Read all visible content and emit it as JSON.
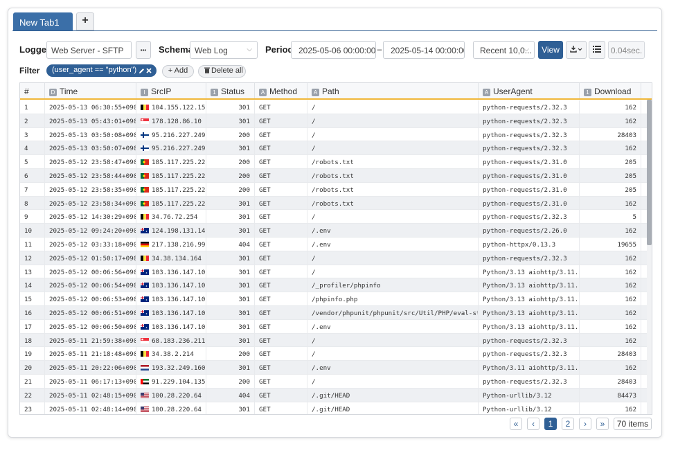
{
  "tabs": {
    "active_label": "New Tab1",
    "add_label": "+"
  },
  "controls": {
    "logger_label": "Logger",
    "logger_value": "Web Server - SFTP",
    "more_label": "•••",
    "schema_label": "Schema",
    "schema_value": "Web Log",
    "period_label": "Period",
    "period_from": "2025-05-06 00:00:00",
    "period_sep": "–",
    "period_to": "2025-05-14 00:00:00",
    "recent_value": "Recent 10,0...",
    "view_label": "View",
    "elapsed": "0.04sec."
  },
  "filter": {
    "label": "Filter",
    "expression": "(user_agent == \"python\")",
    "add_label": "+ Add",
    "delete_label": "Delete all"
  },
  "columns": [
    {
      "type": "",
      "label": "#"
    },
    {
      "type": "D",
      "label": "Time"
    },
    {
      "type": "I",
      "label": "SrcIP"
    },
    {
      "type": "1",
      "label": "Status"
    },
    {
      "type": "A",
      "label": "Method"
    },
    {
      "type": "A",
      "label": "Path"
    },
    {
      "type": "A",
      "label": "UserAgent"
    },
    {
      "type": "1",
      "label": "Download"
    }
  ],
  "rows": [
    [
      "1",
      "2025-05-13 06:30:55+0900",
      "BE",
      "104.155.122.159",
      "301",
      "GET",
      "/",
      "python-requests/2.32.3",
      "162"
    ],
    [
      "2",
      "2025-05-13 05:43:01+0900",
      "SG",
      "178.128.86.10",
      "301",
      "GET",
      "/",
      "python-requests/2.32.3",
      "162"
    ],
    [
      "3",
      "2025-05-13 03:50:08+0900",
      "FI",
      "95.216.227.249",
      "200",
      "GET",
      "/",
      "python-requests/2.32.3",
      "28403"
    ],
    [
      "4",
      "2025-05-13 03:50:07+0900",
      "FI",
      "95.216.227.249",
      "301",
      "GET",
      "/",
      "python-requests/2.32.3",
      "162"
    ],
    [
      "5",
      "2025-05-12 23:58:47+0900",
      "PT",
      "185.117.225.224",
      "200",
      "GET",
      "/robots.txt",
      "python-requests/2.31.0",
      "205"
    ],
    [
      "6",
      "2025-05-12 23:58:44+0900",
      "PT",
      "185.117.225.224",
      "200",
      "GET",
      "/robots.txt",
      "python-requests/2.31.0",
      "205"
    ],
    [
      "7",
      "2025-05-12 23:58:35+0900",
      "PT",
      "185.117.225.224",
      "200",
      "GET",
      "/robots.txt",
      "python-requests/2.31.0",
      "205"
    ],
    [
      "8",
      "2025-05-12 23:58:34+0900",
      "PT",
      "185.117.225.224",
      "301",
      "GET",
      "/robots.txt",
      "python-requests/2.31.0",
      "162"
    ],
    [
      "9",
      "2025-05-12 14:30:29+0900",
      "BE",
      "34.76.72.254",
      "301",
      "GET",
      "/",
      "python-requests/2.32.3",
      "5"
    ],
    [
      "10",
      "2025-05-12 09:24:20+0900",
      "AU",
      "124.198.131.143",
      "301",
      "GET",
      "/.env",
      "python-requests/2.26.0",
      "162"
    ],
    [
      "11",
      "2025-05-12 03:33:18+0900",
      "DE",
      "217.138.216.99",
      "404",
      "GET",
      "/.env",
      "python-httpx/0.13.3",
      "19655"
    ],
    [
      "12",
      "2025-05-12 01:50:17+0900",
      "BE",
      "34.38.134.164",
      "301",
      "GET",
      "/",
      "python-requests/2.32.3",
      "162"
    ],
    [
      "13",
      "2025-05-12 00:06:56+0900",
      "AU",
      "103.136.147.107",
      "301",
      "GET",
      "/",
      "Python/3.13 aiohttp/3.11.12",
      "162"
    ],
    [
      "14",
      "2025-05-12 00:06:54+0900",
      "AU",
      "103.136.147.107",
      "301",
      "GET",
      "/_profiler/phpinfo",
      "Python/3.13 aiohttp/3.11.12",
      "162"
    ],
    [
      "15",
      "2025-05-12 00:06:53+0900",
      "AU",
      "103.136.147.107",
      "301",
      "GET",
      "/phpinfo.php",
      "Python/3.13 aiohttp/3.11.12",
      "162"
    ],
    [
      "16",
      "2025-05-12 00:06:51+0900",
      "AU",
      "103.136.147.107",
      "301",
      "GET",
      "/vendor/phpunit/phpunit/src/Util/PHP/eval-stdin.php",
      "Python/3.13 aiohttp/3.11.12",
      "162"
    ],
    [
      "17",
      "2025-05-12 00:06:50+0900",
      "AU",
      "103.136.147.107",
      "301",
      "GET",
      "/.env",
      "Python/3.13 aiohttp/3.11.12",
      "162"
    ],
    [
      "18",
      "2025-05-11 21:59:38+0900",
      "SG",
      "68.183.236.211",
      "301",
      "GET",
      "/",
      "python-requests/2.32.3",
      "162"
    ],
    [
      "19",
      "2025-05-11 21:18:48+0900",
      "BE",
      "34.38.2.214",
      "200",
      "GET",
      "/",
      "python-requests/2.32.3",
      "28403"
    ],
    [
      "20",
      "2025-05-11 20:22:06+0900",
      "NL",
      "193.32.249.160",
      "301",
      "GET",
      "/.env",
      "Python/3.11 aiohttp/3.11.18",
      "162"
    ],
    [
      "21",
      "2025-05-11 06:17:13+0900",
      "AE",
      "91.229.104.135",
      "200",
      "GET",
      "/",
      "python-requests/2.32.3",
      "28403"
    ],
    [
      "22",
      "2025-05-11 02:48:15+0900",
      "US",
      "100.28.220.64",
      "404",
      "GET",
      "/.git/HEAD",
      "Python-urllib/3.12",
      "84473"
    ],
    [
      "23",
      "2025-05-11 02:48:14+0900",
      "US",
      "100.28.220.64",
      "301",
      "GET",
      "/.git/HEAD",
      "Python-urllib/3.12",
      "162"
    ]
  ],
  "pagination": {
    "first": "«",
    "prev": "‹",
    "pages": [
      "1",
      "2"
    ],
    "next": "›",
    "last": "»",
    "total": "70 items"
  },
  "colors": {
    "accent": "#2f5f95",
    "tab": "#3b6fa8",
    "header_rule": "#f0b73a",
    "row_alt": "#eef0f3"
  }
}
